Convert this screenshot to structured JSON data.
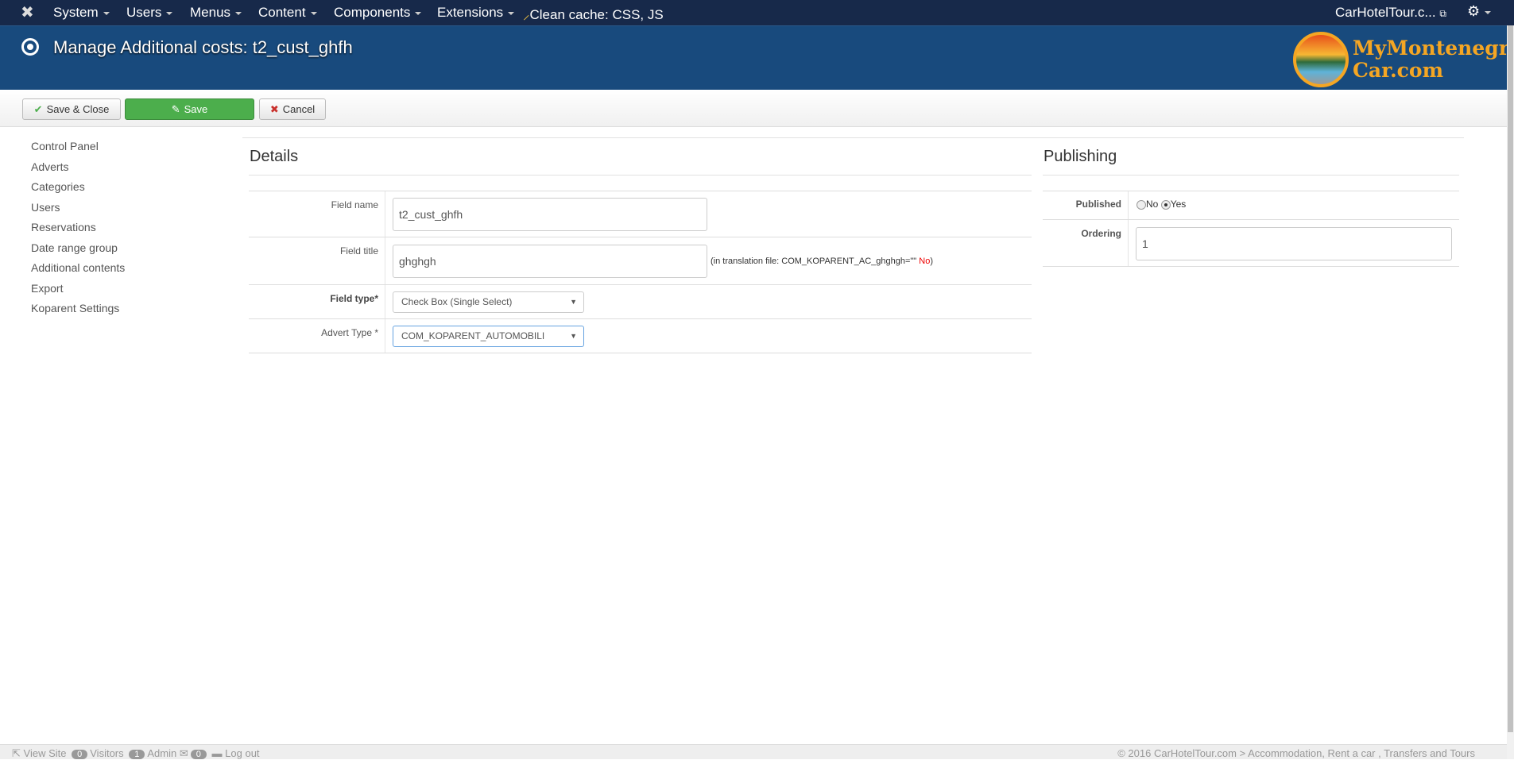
{
  "topnav": {
    "items": [
      "System",
      "Users",
      "Menus",
      "Content",
      "Components",
      "Extensions"
    ],
    "clean_cache": "Clean cache: CSS, JS",
    "site": "CarHotelTour.c..."
  },
  "header": {
    "title": "Manage Additional costs: t2_cust_ghfh",
    "logo_line1": "MyMontenegro",
    "logo_line2": "Car.com"
  },
  "toolbar": {
    "save_close": "Save & Close",
    "save": "Save",
    "cancel": "Cancel"
  },
  "sidebar": {
    "items": [
      "Control Panel",
      "Adverts",
      "Categories",
      "Users",
      "Reservations",
      "Date range group",
      "Additional contents",
      "Export",
      "Koparent Settings"
    ]
  },
  "details": {
    "heading": "Details",
    "field_name": {
      "label": "Field name",
      "value": "t2_cust_ghfh"
    },
    "field_title": {
      "label": "Field title",
      "value": "ghghgh",
      "note": "(in translation file: COM_KOPARENT_AC_ghghgh=\"\"",
      "note_status": "No",
      "note_end": ")"
    },
    "field_type": {
      "label": "Field type*",
      "value": "Check Box (Single Select)"
    },
    "advert_type": {
      "label": "Advert Type *",
      "value": "COM_KOPARENT_AUTOMOBILI"
    }
  },
  "publishing": {
    "heading": "Publishing",
    "published_label": "Published",
    "no": "No",
    "yes": "Yes",
    "selected": "Yes",
    "ordering_label": "Ordering",
    "ordering_value": "1"
  },
  "footer": {
    "view_site": "View Site",
    "visitors_count": "0",
    "visitors": "Visitors",
    "admin_count": "1",
    "admin": "Admin",
    "messages_count": "0",
    "logout": "Log out",
    "copyright": "© 2016 CarHotelTour.com > Accommodation, Rent a car , Transfers and Tours"
  }
}
